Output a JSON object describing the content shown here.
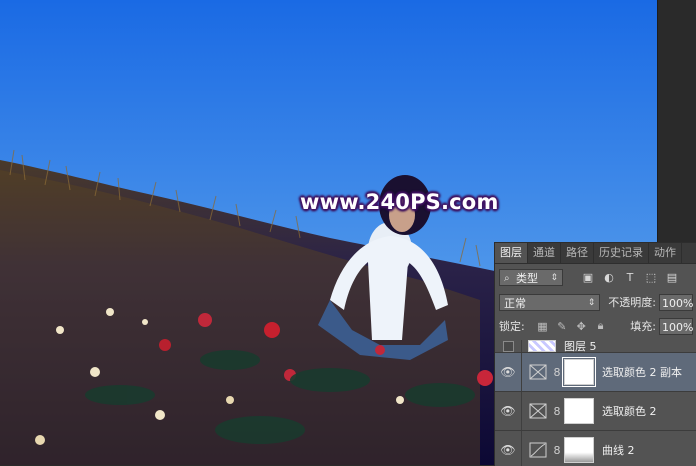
{
  "watermark": {
    "text": "www.240PS.com"
  },
  "layers_panel": {
    "tabs": [
      {
        "label": "图层",
        "active": true
      },
      {
        "label": "通道",
        "active": false
      },
      {
        "label": "路径",
        "active": false
      },
      {
        "label": "历史记录",
        "active": false
      },
      {
        "label": "动作",
        "active": false
      }
    ],
    "filter": {
      "kind_label": "类型",
      "icons": [
        "image-filter-icon",
        "adjustment-filter-icon",
        "type-filter-icon",
        "shape-filter-icon",
        "smart-object-filter-icon"
      ]
    },
    "blend_mode": "正常",
    "opacity_label": "不透明度:",
    "opacity_value": "100%",
    "lock_label": "锁定:",
    "lock_icons": [
      "lock-transparent-icon",
      "lock-image-icon",
      "lock-position-icon",
      "lock-all-icon"
    ],
    "fill_label": "填充:",
    "fill_value": "100%",
    "layers": [
      {
        "name": "图层 5",
        "visible": false,
        "type": "pixel",
        "selected": false
      },
      {
        "name": "选取颜色 2 副本",
        "visible": true,
        "type": "selective-color",
        "selected": true
      },
      {
        "name": "选取颜色 2",
        "visible": true,
        "type": "selective-color",
        "selected": false
      },
      {
        "name": "曲线 2",
        "visible": true,
        "type": "curves",
        "selected": false
      }
    ]
  },
  "colors": {
    "sky_top": "#1d6fe6",
    "sky_bottom": "#7ab6ee",
    "field_dark": "#0e0a3a",
    "panel_bg": "#535353",
    "selected_row": "#5f6a7a"
  }
}
